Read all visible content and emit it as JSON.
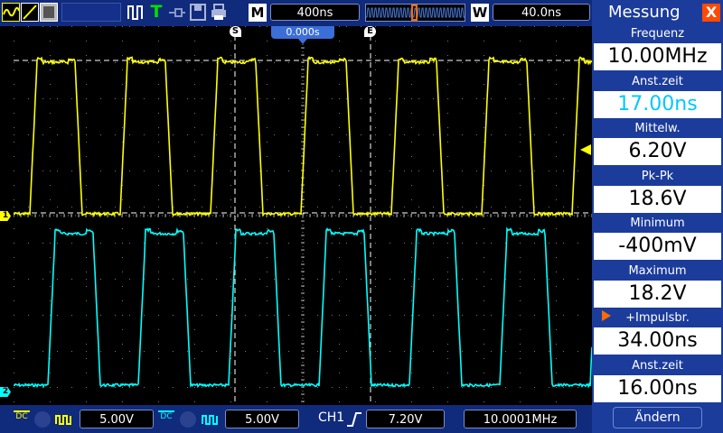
{
  "colors": {
    "ch1": "#ffff00",
    "ch2": "#00ffff",
    "toolbar": "#102a7c",
    "panel": "#1c3c9c",
    "close": "#ff4a00"
  },
  "toolbar": {
    "icons": [
      "ch1-wave-icon",
      "cursor-icon",
      "display-icon",
      "pulse-icon",
      "trigger-icon",
      "probe-icon",
      "save-icon",
      "print-icon"
    ],
    "trigger_letter": "T",
    "main_label": "M",
    "timebase": "400ns",
    "window_label": "W",
    "window_timebase": "40.0ns"
  },
  "screen": {
    "trigger_position": "0.000s",
    "start_marker": "S",
    "end_marker": "E",
    "ch1_marker": "1",
    "ch2_marker": "2"
  },
  "panel": {
    "title": "Messung",
    "close_label": "X",
    "measurements": [
      {
        "label": "Frequenz",
        "value": "10.00MHz",
        "value_color": "#000000"
      },
      {
        "label": "Anst.zeit",
        "value": "17.00ns",
        "value_color": "#00c8ff"
      },
      {
        "label": "Mittelw.",
        "value": "6.20V",
        "value_color": "#000000"
      },
      {
        "label": "Pk-Pk",
        "value": "18.6V",
        "value_color": "#000000"
      },
      {
        "label": "Minimum",
        "value": "-400mV",
        "value_color": "#000000"
      },
      {
        "label": "Maximum",
        "value": "18.2V",
        "value_color": "#000000"
      },
      {
        "label": "+Impulsbr.",
        "value": "34.00ns",
        "value_color": "#000000"
      },
      {
        "label": "Anst.zeit",
        "value": "16.00ns",
        "value_color": "#000000"
      }
    ],
    "change_button": "Ändern"
  },
  "bottombar": {
    "ch1_coupling": "DC",
    "ch1_scale": "5.00V",
    "ch2_coupling": "DC",
    "ch2_scale": "5.00V",
    "trigger_source": "CH1",
    "trigger_level": "7.20V",
    "trigger_frequency": "10.0001MHz"
  }
}
